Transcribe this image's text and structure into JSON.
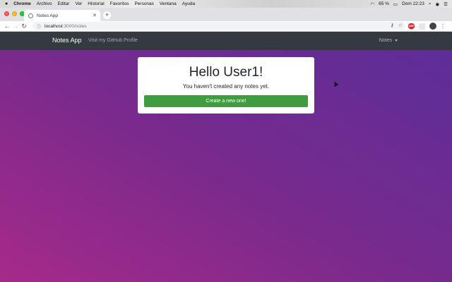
{
  "menubar": {
    "apple": "",
    "items": [
      "Chrome",
      "Archivo",
      "Editar",
      "Ver",
      "Historial",
      "Favoritos",
      "Personas",
      "Ventana",
      "Ayuda"
    ],
    "battery": "65 %",
    "clock": "Dom 22:23"
  },
  "browser": {
    "tab_title": "Notes App",
    "url_host": "localhost",
    "url_path": ":3000/notes"
  },
  "navbar": {
    "brand": "Notes App",
    "github_link": "Visit my GitHub Profile",
    "dropdown_label": "Notes"
  },
  "card": {
    "greeting": "Hello User1!",
    "message": "You haven't created any notes yet.",
    "button": "Create a new one!"
  },
  "colors": {
    "navbar": "#343a40",
    "button": "#3f9c3f",
    "gradient_start": "#a62a8a",
    "gradient_end": "#5a2e9a"
  }
}
